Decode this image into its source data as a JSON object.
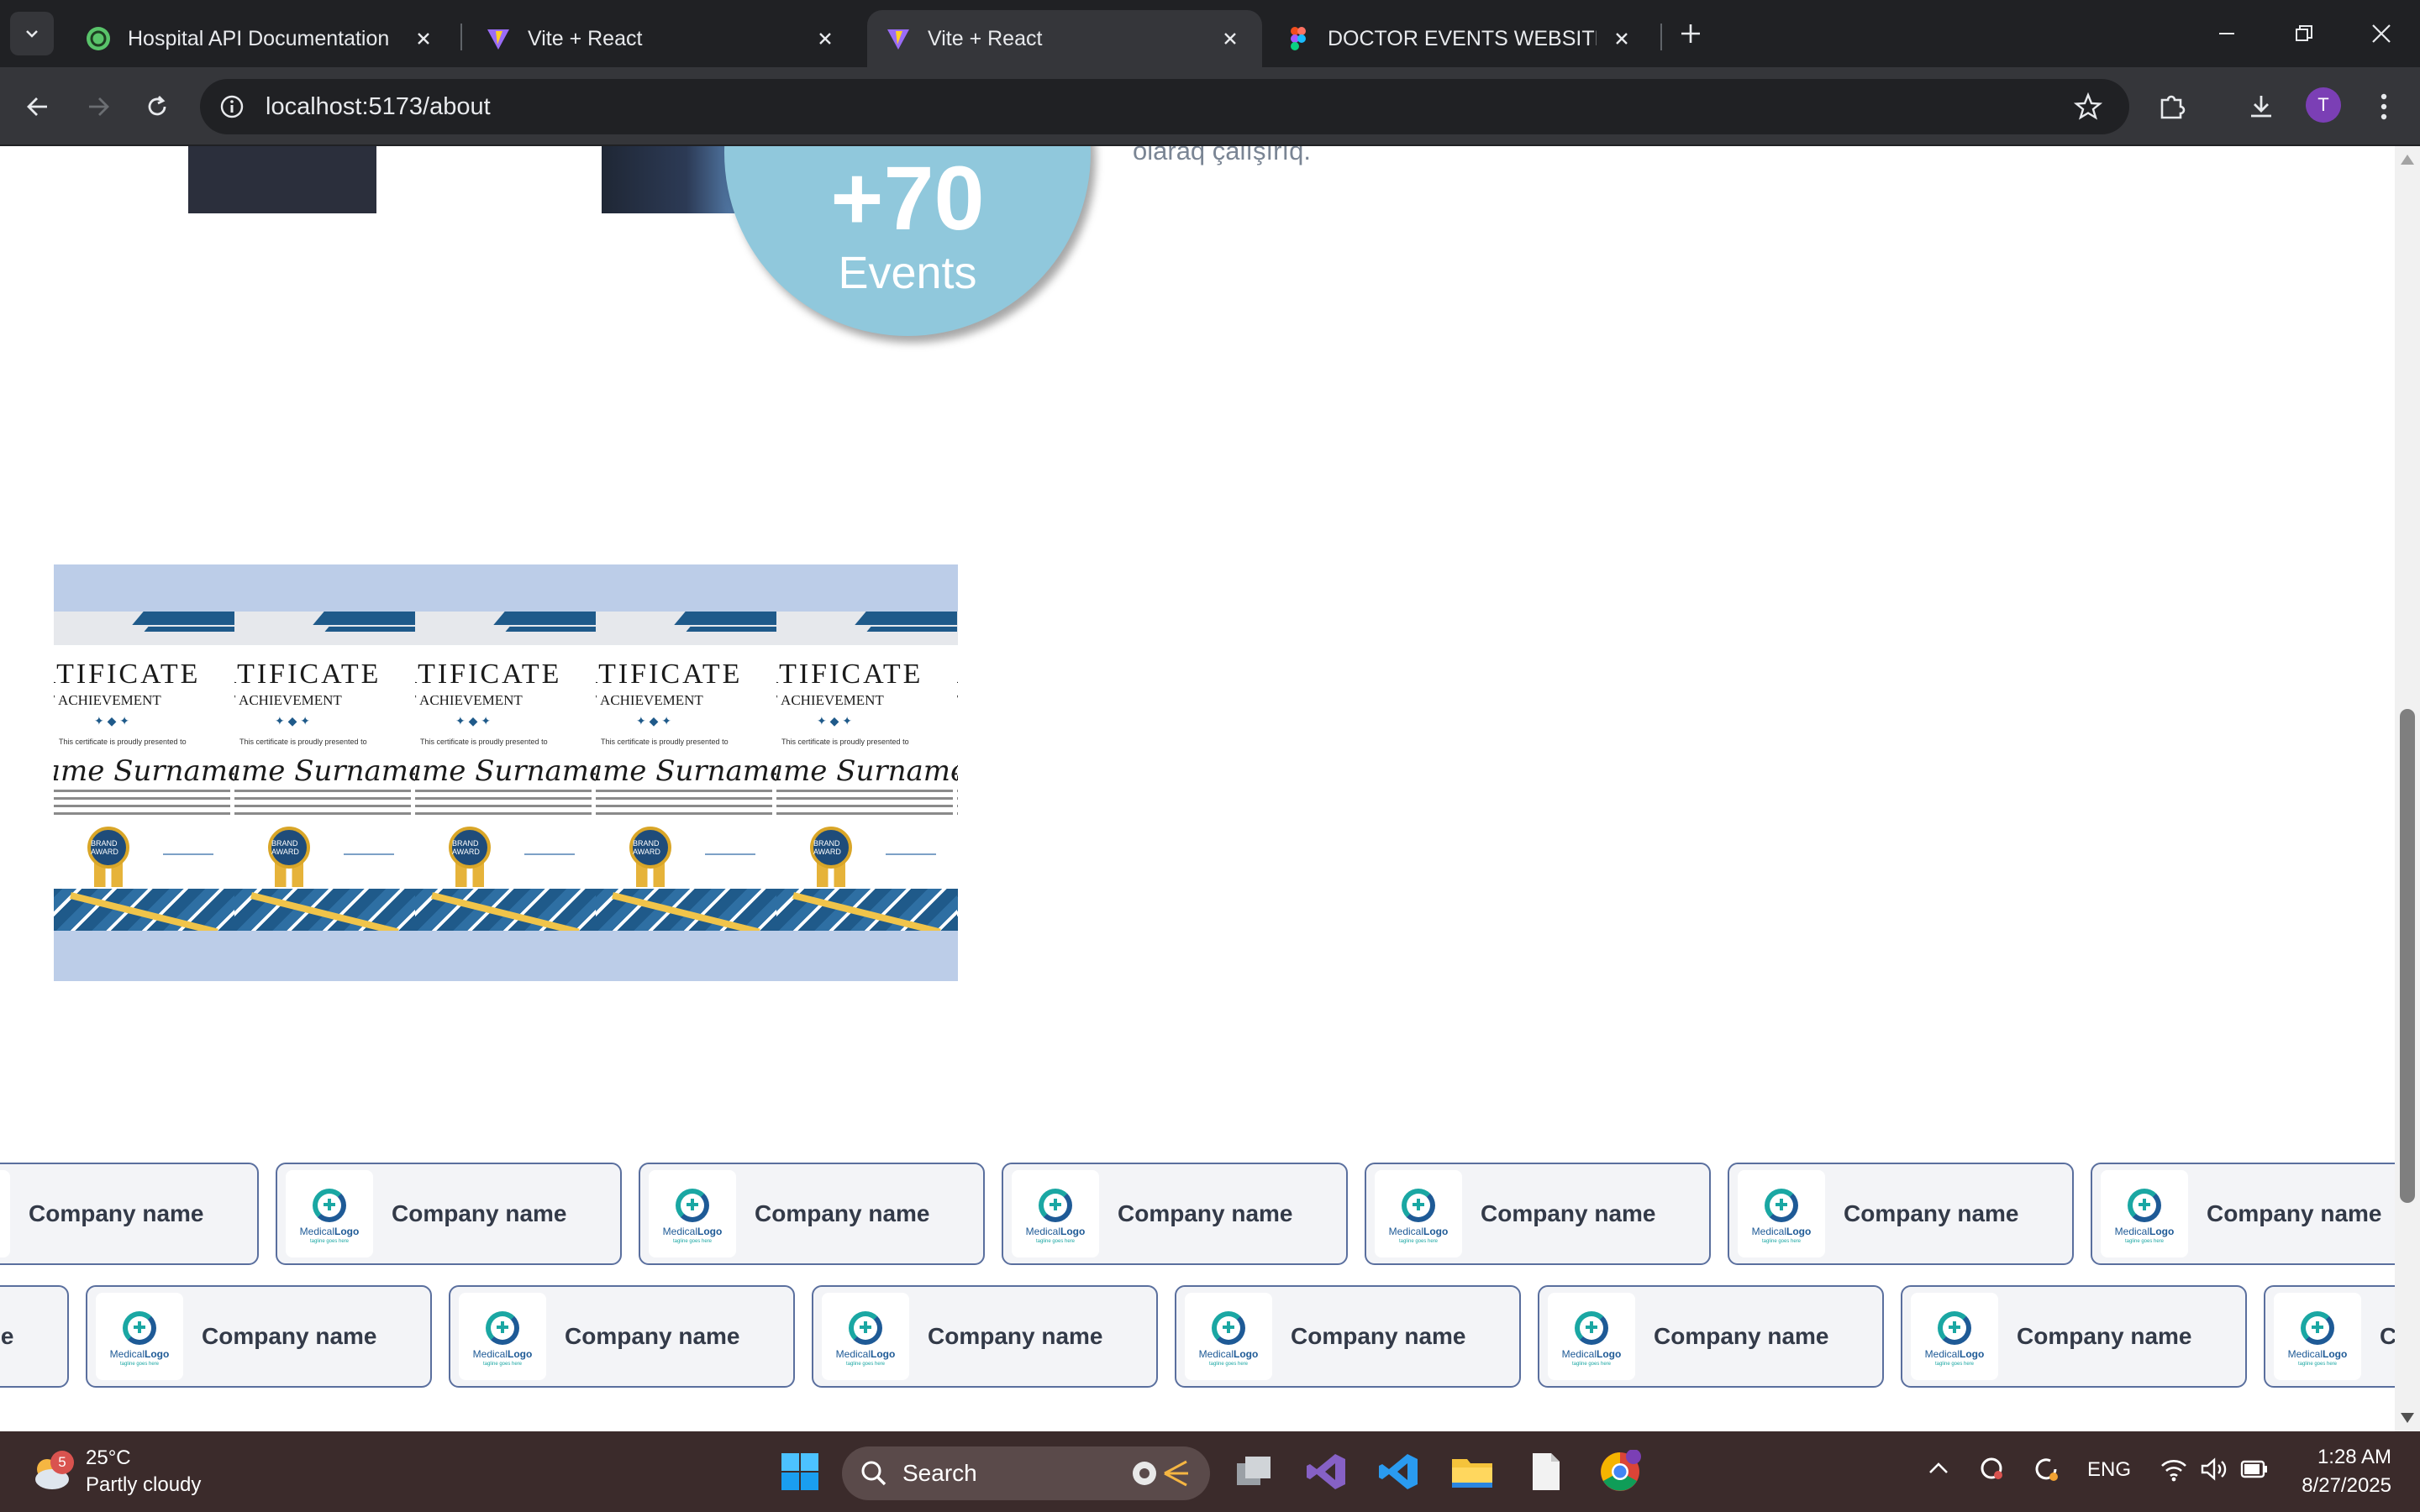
{
  "browser": {
    "tabs": [
      {
        "title": "Hospital API Documentation",
        "favicon": "api-docs-icon",
        "active": false
      },
      {
        "title": "Vite + React",
        "favicon": "vite-icon",
        "active": false
      },
      {
        "title": "Vite + React",
        "favicon": "vite-icon",
        "active": true
      },
      {
        "title": "DOCTOR EVENTS WEBSITE – Fig",
        "favicon": "figma-icon",
        "active": false
      }
    ],
    "url": "localhost:5173/about",
    "profile_initial": "T"
  },
  "page": {
    "about_text_fragment": "olaraq çalışırıq.",
    "events": {
      "count": "+70",
      "label": "Events"
    },
    "certificate": {
      "title": "CERTIFICATE",
      "subtitle": "OF ACHIEVEMENT",
      "presented": "This certificate is proudly presented to",
      "name": "Name Surname",
      "badge": "BRAND AWARD",
      "repeat_count": 5
    },
    "companies": {
      "name": "Company name",
      "logo_text_1": "Medical",
      "logo_text_2": "Logo",
      "logo_tagline": "tagline goes here",
      "row1_count": 7,
      "row2_count": 7
    }
  },
  "taskbar": {
    "weather": {
      "temp": "25°C",
      "condition": "Partly cloudy",
      "badge": "5"
    },
    "search_placeholder": "Search",
    "language": "ENG",
    "time": "1:28 AM",
    "date": "8/27/2025"
  },
  "colors": {
    "chrome_bg": "#202124",
    "toolbar_bg": "#35363a",
    "events_circle": "#90c8dc",
    "certificate_frame": "#bccde8",
    "card_border": "#5a6f9e",
    "taskbar_bg": "#3b2b2b"
  }
}
